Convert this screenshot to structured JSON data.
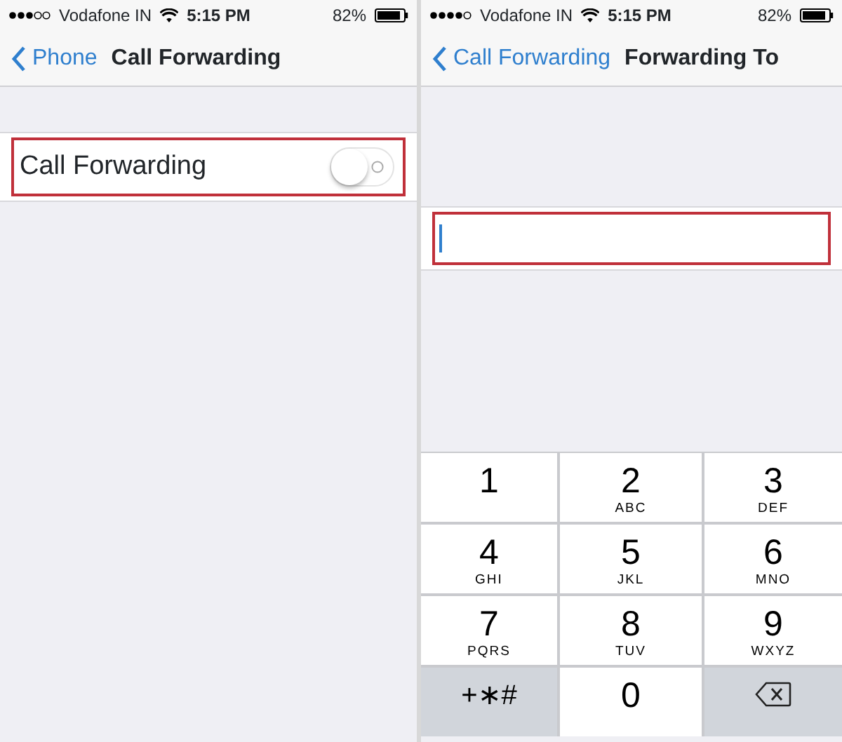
{
  "screens": [
    {
      "status_bar": {
        "carrier": "Vodafone IN",
        "time": "5:15 PM",
        "battery": "82%"
      },
      "nav_bar": {
        "back": "Phone",
        "title": "Call Forwarding"
      },
      "cells": [
        {
          "kind": "switch",
          "label": "Call Forwarding",
          "on": false,
          "highlighted": true
        }
      ]
    },
    {
      "status_bar": {
        "carrier": "Vodafone IN",
        "time": "5:15 PM",
        "battery": "82%"
      },
      "nav_bar": {
        "back": "Call Forwarding",
        "title": "Forwarding To"
      },
      "cells": [
        {
          "kind": "field",
          "highlighted": true
        }
      ],
      "keypad": [
        {
          "kind": "digit",
          "digit": "1"
        },
        {
          "kind": "digit",
          "digit": "2",
          "letters": "ABC"
        },
        {
          "kind": "digit",
          "digit": "3",
          "letters": "DEF"
        },
        {
          "kind": "digit",
          "digit": "4",
          "letters": "GHI"
        },
        {
          "kind": "digit",
          "digit": "5",
          "letters": "JKL"
        },
        {
          "kind": "digit",
          "digit": "6",
          "letters": "MNO"
        },
        {
          "kind": "digit",
          "digit": "7",
          "letters": "PQRS"
        },
        {
          "kind": "digit",
          "digit": "8",
          "letters": "TUV"
        },
        {
          "kind": "digit",
          "digit": "9",
          "letters": "WXYZ"
        },
        {
          "kind": "symbols",
          "label": "+∗#"
        },
        {
          "kind": "digit",
          "digit": "0"
        },
        {
          "kind": "delete"
        }
      ]
    }
  ]
}
